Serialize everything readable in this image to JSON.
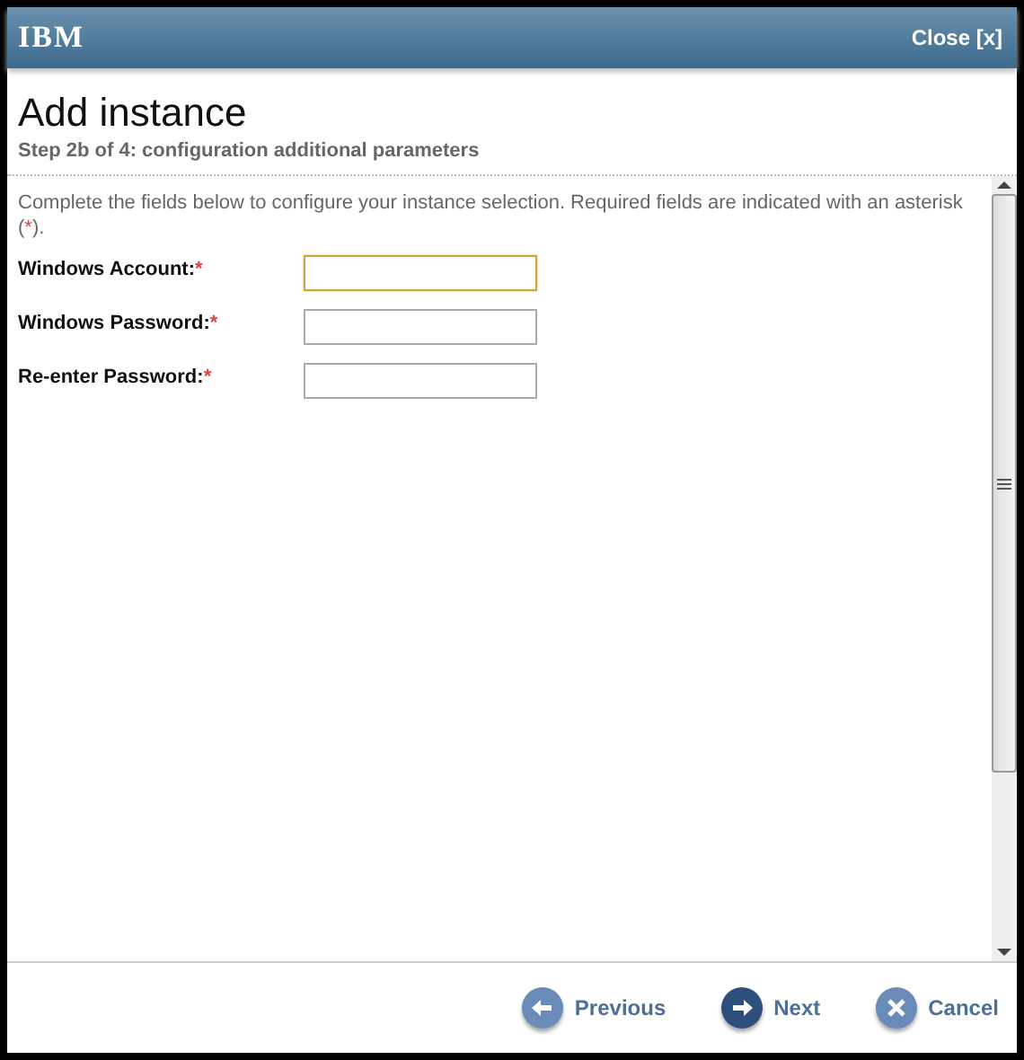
{
  "header": {
    "logo": "IBM",
    "close": "Close [x]"
  },
  "title": "Add instance",
  "subtitle": "Step 2b of 4: configuration additional parameters",
  "intro": "Complete the fields below to configure your instance selection. Required fields are indicated with an asterisk",
  "intro_open": "(",
  "intro_mark": "*",
  "intro_close": ").",
  "fields": [
    {
      "label": "Windows Account:",
      "required": "*",
      "focused": true
    },
    {
      "label": "Windows Password:",
      "required": "*",
      "focused": false
    },
    {
      "label": "Re-enter Password:",
      "required": "*",
      "focused": false
    }
  ],
  "buttons": [
    {
      "kind": "previous",
      "label": "Previous",
      "primary": false
    },
    {
      "kind": "next",
      "label": "Next",
      "primary": true
    },
    {
      "kind": "cancel",
      "label": "Cancel",
      "primary": false
    }
  ]
}
